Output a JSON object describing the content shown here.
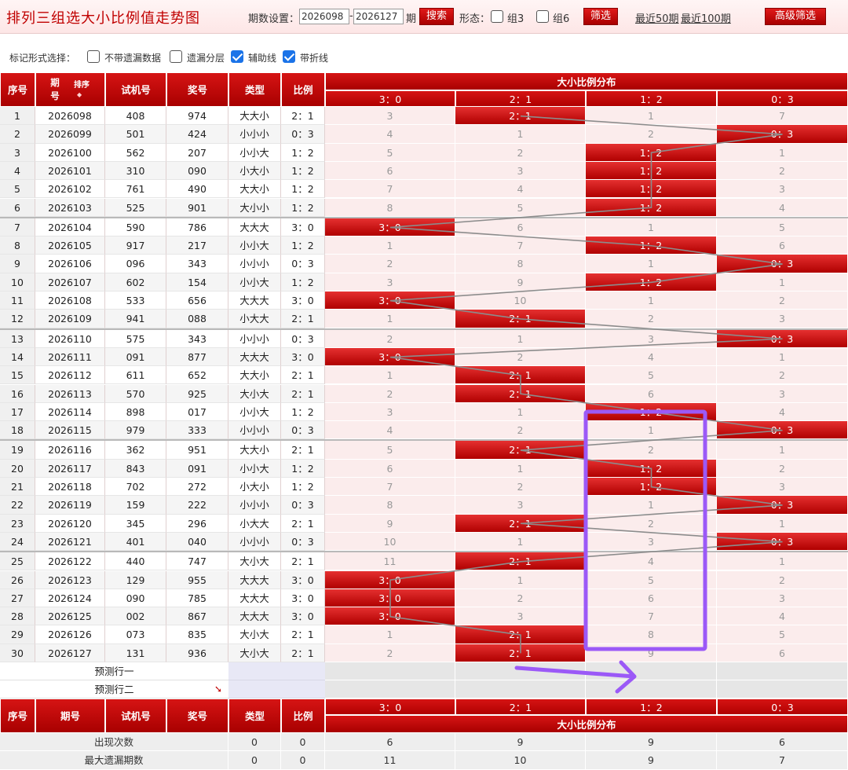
{
  "header": {
    "title": "排列三组选大小比例值走势图",
    "period_label": "期数设置：",
    "period_from": "2026098",
    "period_dash": "-",
    "period_to": "2026127",
    "period_unit": "期",
    "search_label": "搜索",
    "shape_label": "形态：",
    "group3_label": "组3",
    "group6_label": "组6",
    "filter_label": "筛选",
    "recent50_label": "最近50期",
    "recent100_label": "最近100期",
    "advanced_label": "高级筛选"
  },
  "markbar": {
    "label": "标记形式选择：",
    "options": [
      {
        "label": "不带遗漏数据",
        "checked": false
      },
      {
        "label": "遗漏分层",
        "checked": false
      },
      {
        "label": "辅助线",
        "checked": true
      },
      {
        "label": "带折线",
        "checked": true
      }
    ]
  },
  "table": {
    "columns": {
      "seq": "序号",
      "issue": "期号",
      "sort": "排序",
      "trial": "试机号",
      "prize": "奖号",
      "type": "类型",
      "ratio": "比例",
      "dist_title": "大小比例分布"
    },
    "dist_cols": [
      "3：0",
      "2：1",
      "1：2",
      "0：3"
    ],
    "rows": [
      {
        "seq": "1",
        "issue": "2026098",
        "trial": "408",
        "prize": "974",
        "type": "大大小",
        "ratio": "2：1",
        "hit": 1,
        "miss": [
          "3",
          "",
          "1",
          "7"
        ]
      },
      {
        "seq": "2",
        "issue": "2026099",
        "trial": "501",
        "prize": "424",
        "type": "小小小",
        "ratio": "0：3",
        "hit": 3,
        "miss": [
          "4",
          "1",
          "2",
          ""
        ]
      },
      {
        "seq": "3",
        "issue": "2026100",
        "trial": "562",
        "prize": "207",
        "type": "小小大",
        "ratio": "1：2",
        "hit": 2,
        "miss": [
          "5",
          "2",
          "",
          "1"
        ]
      },
      {
        "seq": "4",
        "issue": "2026101",
        "trial": "310",
        "prize": "090",
        "type": "小大小",
        "ratio": "1：2",
        "hit": 2,
        "miss": [
          "6",
          "3",
          "",
          "2"
        ]
      },
      {
        "seq": "5",
        "issue": "2026102",
        "trial": "761",
        "prize": "490",
        "type": "大大小",
        "ratio": "1：2",
        "hit": 2,
        "miss": [
          "7",
          "4",
          "",
          "3"
        ]
      },
      {
        "seq": "6",
        "issue": "2026103",
        "trial": "525",
        "prize": "901",
        "type": "大小小",
        "ratio": "1：2",
        "hit": 2,
        "miss": [
          "8",
          "5",
          "",
          "4"
        ]
      },
      {
        "seq": "7",
        "issue": "2026104",
        "trial": "590",
        "prize": "786",
        "type": "大大大",
        "ratio": "3：0",
        "hit": 0,
        "miss": [
          "",
          "6",
          "1",
          "5"
        ]
      },
      {
        "seq": "8",
        "issue": "2026105",
        "trial": "917",
        "prize": "217",
        "type": "小小大",
        "ratio": "1：2",
        "hit": 2,
        "miss": [
          "1",
          "7",
          "",
          "6"
        ]
      },
      {
        "seq": "9",
        "issue": "2026106",
        "trial": "096",
        "prize": "343",
        "type": "小小小",
        "ratio": "0：3",
        "hit": 3,
        "miss": [
          "2",
          "8",
          "1",
          ""
        ]
      },
      {
        "seq": "10",
        "issue": "2026107",
        "trial": "602",
        "prize": "154",
        "type": "小小大",
        "ratio": "1：2",
        "hit": 2,
        "miss": [
          "3",
          "9",
          "",
          "1"
        ]
      },
      {
        "seq": "11",
        "issue": "2026108",
        "trial": "533",
        "prize": "656",
        "type": "大大大",
        "ratio": "3：0",
        "hit": 0,
        "miss": [
          "",
          "10",
          "1",
          "2"
        ]
      },
      {
        "seq": "12",
        "issue": "2026109",
        "trial": "941",
        "prize": "088",
        "type": "小大大",
        "ratio": "2：1",
        "hit": 1,
        "miss": [
          "1",
          "",
          "2",
          "3"
        ]
      },
      {
        "seq": "13",
        "issue": "2026110",
        "trial": "575",
        "prize": "343",
        "type": "小小小",
        "ratio": "0：3",
        "hit": 3,
        "miss": [
          "2",
          "1",
          "3",
          ""
        ]
      },
      {
        "seq": "14",
        "issue": "2026111",
        "trial": "091",
        "prize": "877",
        "type": "大大大",
        "ratio": "3：0",
        "hit": 0,
        "miss": [
          "",
          "2",
          "4",
          "1"
        ]
      },
      {
        "seq": "15",
        "issue": "2026112",
        "trial": "611",
        "prize": "652",
        "type": "大大小",
        "ratio": "2：1",
        "hit": 1,
        "miss": [
          "1",
          "",
          "5",
          "2"
        ]
      },
      {
        "seq": "16",
        "issue": "2026113",
        "trial": "570",
        "prize": "925",
        "type": "大小大",
        "ratio": "2：1",
        "hit": 1,
        "miss": [
          "2",
          "",
          "6",
          "3"
        ]
      },
      {
        "seq": "17",
        "issue": "2026114",
        "trial": "898",
        "prize": "017",
        "type": "小小大",
        "ratio": "1：2",
        "hit": 2,
        "miss": [
          "3",
          "1",
          "",
          "4"
        ]
      },
      {
        "seq": "18",
        "issue": "2026115",
        "trial": "979",
        "prize": "333",
        "type": "小小小",
        "ratio": "0：3",
        "hit": 3,
        "miss": [
          "4",
          "2",
          "1",
          ""
        ]
      },
      {
        "seq": "19",
        "issue": "2026116",
        "trial": "362",
        "prize": "951",
        "type": "大大小",
        "ratio": "2：1",
        "hit": 1,
        "miss": [
          "5",
          "",
          "2",
          "1"
        ]
      },
      {
        "seq": "20",
        "issue": "2026117",
        "trial": "843",
        "prize": "091",
        "type": "小小大",
        "ratio": "1：2",
        "hit": 2,
        "miss": [
          "6",
          "1",
          "",
          "2"
        ]
      },
      {
        "seq": "21",
        "issue": "2026118",
        "trial": "702",
        "prize": "272",
        "type": "小大小",
        "ratio": "1：2",
        "hit": 2,
        "miss": [
          "7",
          "2",
          "",
          "3"
        ]
      },
      {
        "seq": "22",
        "issue": "2026119",
        "trial": "159",
        "prize": "222",
        "type": "小小小",
        "ratio": "0：3",
        "hit": 3,
        "miss": [
          "8",
          "3",
          "1",
          ""
        ]
      },
      {
        "seq": "23",
        "issue": "2026120",
        "trial": "345",
        "prize": "296",
        "type": "小大大",
        "ratio": "2：1",
        "hit": 1,
        "miss": [
          "9",
          "",
          "2",
          "1"
        ]
      },
      {
        "seq": "24",
        "issue": "2026121",
        "trial": "401",
        "prize": "040",
        "type": "小小小",
        "ratio": "0：3",
        "hit": 3,
        "miss": [
          "10",
          "1",
          "3",
          ""
        ]
      },
      {
        "seq": "25",
        "issue": "2026122",
        "trial": "440",
        "prize": "747",
        "type": "大小大",
        "ratio": "2：1",
        "hit": 1,
        "miss": [
          "11",
          "",
          "4",
          "1"
        ]
      },
      {
        "seq": "26",
        "issue": "2026123",
        "trial": "129",
        "prize": "955",
        "type": "大大大",
        "ratio": "3：0",
        "hit": 0,
        "miss": [
          "",
          "1",
          "5",
          "2"
        ]
      },
      {
        "seq": "27",
        "issue": "2026124",
        "trial": "090",
        "prize": "785",
        "type": "大大大",
        "ratio": "3：0",
        "hit": 0,
        "miss": [
          "",
          "2",
          "6",
          "3"
        ]
      },
      {
        "seq": "28",
        "issue": "2026125",
        "trial": "002",
        "prize": "867",
        "type": "大大大",
        "ratio": "3：0",
        "hit": 0,
        "miss": [
          "",
          "3",
          "7",
          "4"
        ]
      },
      {
        "seq": "29",
        "issue": "2026126",
        "trial": "073",
        "prize": "835",
        "type": "大小大",
        "ratio": "2：1",
        "hit": 1,
        "miss": [
          "1",
          "",
          "8",
          "5"
        ]
      },
      {
        "seq": "30",
        "issue": "2026127",
        "trial": "131",
        "prize": "936",
        "type": "大小大",
        "ratio": "2：1",
        "hit": 1,
        "miss": [
          "2",
          "",
          "9",
          "6"
        ]
      }
    ],
    "predict1": "预测行一",
    "predict2": "预测行二",
    "footer_dist_title": "大小比例分布",
    "stats": [
      {
        "label": "出现次数",
        "type": "0",
        "ratio": "0",
        "values": [
          "6",
          "9",
          "9",
          "6"
        ]
      },
      {
        "label": "最大遗漏期数",
        "type": "0",
        "ratio": "0",
        "values": [
          "11",
          "10",
          "9",
          "7"
        ]
      }
    ]
  },
  "annotation": {
    "color": "#9b59f7"
  },
  "colors": {
    "accent": "#c00000",
    "hit": "#c81414",
    "dist_bg": "#fbecec",
    "line": "#8c8c8c"
  }
}
